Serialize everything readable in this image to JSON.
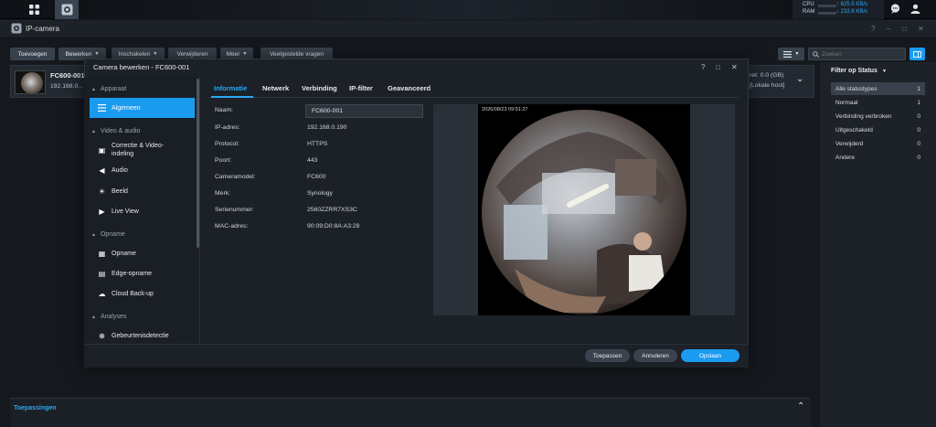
{
  "taskbar": {
    "main_menu_icon": "grid-icon",
    "app_icon": "camera-app-icon",
    "cpu_label": "CPU",
    "ram_label": "RAM",
    "upload_rate": "↑ 625.5 KB/s",
    "download_rate": "↓ 232.8 KB/s"
  },
  "app": {
    "title": "IP-camera",
    "win_help": "?",
    "win_minimize": "–",
    "win_maximize": "□",
    "win_close": "✕"
  },
  "toolbar": {
    "add": "Toevoegen",
    "edit": "Bewerken",
    "enable": "Inschakelen",
    "delete": "Verwijderen",
    "more": "Meer",
    "faq": "Veelgestelde vragen",
    "search_placeholder": "Zoeken"
  },
  "camera_card": {
    "name": "FC600-001",
    "ip": "192.168.0...",
    "storage": "ret: 0.0 (GB)",
    "host": "[Lokale host]"
  },
  "filter": {
    "title": "Filter op Status",
    "items": [
      {
        "label": "Alle statustypes",
        "count": "1"
      },
      {
        "label": "Normaal",
        "count": "1"
      },
      {
        "label": "Verbinding verbroken",
        "count": "0"
      },
      {
        "label": "Uitgeschakeld",
        "count": "0"
      },
      {
        "label": "Verwijderd",
        "count": "0"
      },
      {
        "label": "Andere",
        "count": "0"
      }
    ]
  },
  "bottom": {
    "title": "Toepassingen"
  },
  "modal": {
    "title": "Camera bewerken - FC600-001",
    "help": "?",
    "maximize": "□",
    "close": "✕",
    "nav": {
      "sec_device": "Apparaat",
      "general": "Algemeen",
      "sec_video": "Video & audio",
      "correction": "Correctie & Video-indeling",
      "audio": "Audio",
      "image": "Beeld",
      "live": "Live View",
      "sec_record": "Opname",
      "recording": "Opname",
      "edge": "Edge-opname",
      "cloud": "Cloud Back-up",
      "sec_analyses": "Analyses",
      "events": "Gebeurtenisdetectie"
    },
    "tabs": [
      "Informatie",
      "Netwerk",
      "Verbinding",
      "IP-filter",
      "Geavanceerd"
    ],
    "fields": {
      "name_label": "Naam:",
      "name_value": "FC600-001",
      "ip_label": "IP-adres:",
      "ip_value": "192.168.0.190",
      "protocol_label": "Protocol:",
      "protocol_value": "HTTPS",
      "port_label": "Poort:",
      "port_value": "443",
      "model_label": "Cameramodel:",
      "model_value": "FC600",
      "brand_label": "Merk:",
      "brand_value": "Synology",
      "serial_label": "Serienummer:",
      "serial_value": "2560ZZRR7XS3C",
      "mac_label": "MAC-adres:",
      "mac_value": "90:09:D0:8A:A3:28"
    },
    "preview_timestamp": "2026/08/23 09:51:27",
    "buttons": {
      "apply": "Toepassen",
      "cancel": "Annuleren",
      "save": "Opslaan"
    }
  }
}
